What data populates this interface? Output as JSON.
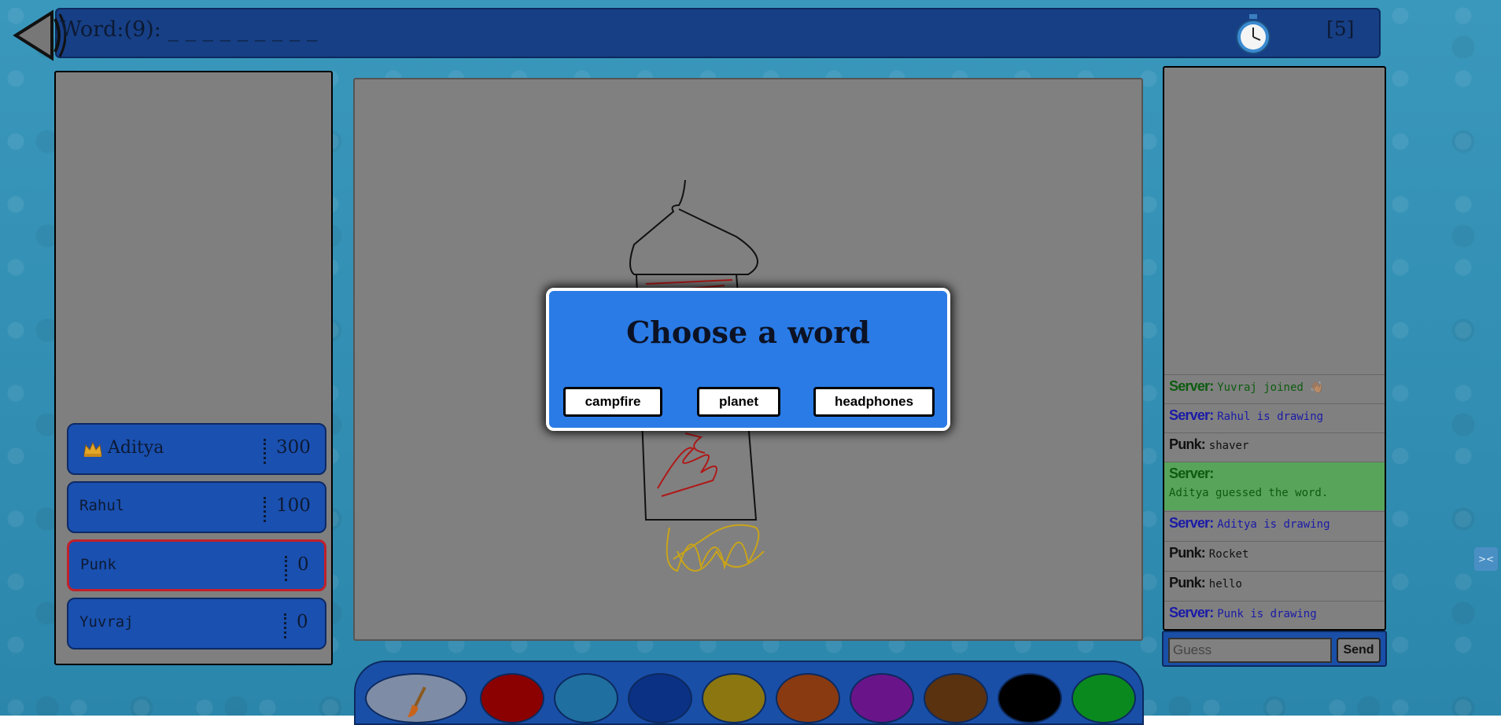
{
  "header": {
    "word_label": "Word:(9): _ _ _ _ _ _ _ _ _",
    "timer_value": "[5]"
  },
  "players": [
    {
      "name": "Aditya",
      "score": "300",
      "is_owner": true
    },
    {
      "name": "Rahul",
      "score": "100"
    },
    {
      "name": "Punk",
      "score": "0",
      "is_drawing": true
    },
    {
      "name": "Yuvraj",
      "score": "0"
    }
  ],
  "modal": {
    "title": "Choose a word",
    "options": [
      "campfire",
      "planet",
      "headphones"
    ]
  },
  "chat": {
    "messages": [
      {
        "sender": "Server:",
        "text": "Yuvraj joined 👋🏽",
        "type": "server-join"
      },
      {
        "sender": "Server:",
        "text": "Rahul is drawing",
        "type": "server-info"
      },
      {
        "sender": "Punk:",
        "text": "shaver",
        "type": "player"
      },
      {
        "sender": "Server:",
        "text": "Aditya guessed the word.",
        "type": "server-guess"
      },
      {
        "sender": "Server:",
        "text": "Aditya is drawing",
        "type": "server-info"
      },
      {
        "sender": "Punk:",
        "text": "Rocket",
        "type": "player"
      },
      {
        "sender": "Punk:",
        "text": "hello",
        "type": "player"
      },
      {
        "sender": "Server:",
        "text": "Punk is drawing",
        "type": "server-info"
      }
    ],
    "guess_placeholder": "Guess",
    "send_label": "Send"
  },
  "palette": {
    "colors": [
      "#8b0000",
      "#1f6fa0",
      "#0a3184",
      "#8b7610",
      "#8a3a10",
      "#6a148a",
      "#5a3210",
      "#000000",
      "#0a8a1e"
    ],
    "tool": "brush-icon"
  },
  "icons": {
    "back": "back-arrow-icon",
    "timer": "stopwatch-icon",
    "crown": "crown-icon"
  }
}
